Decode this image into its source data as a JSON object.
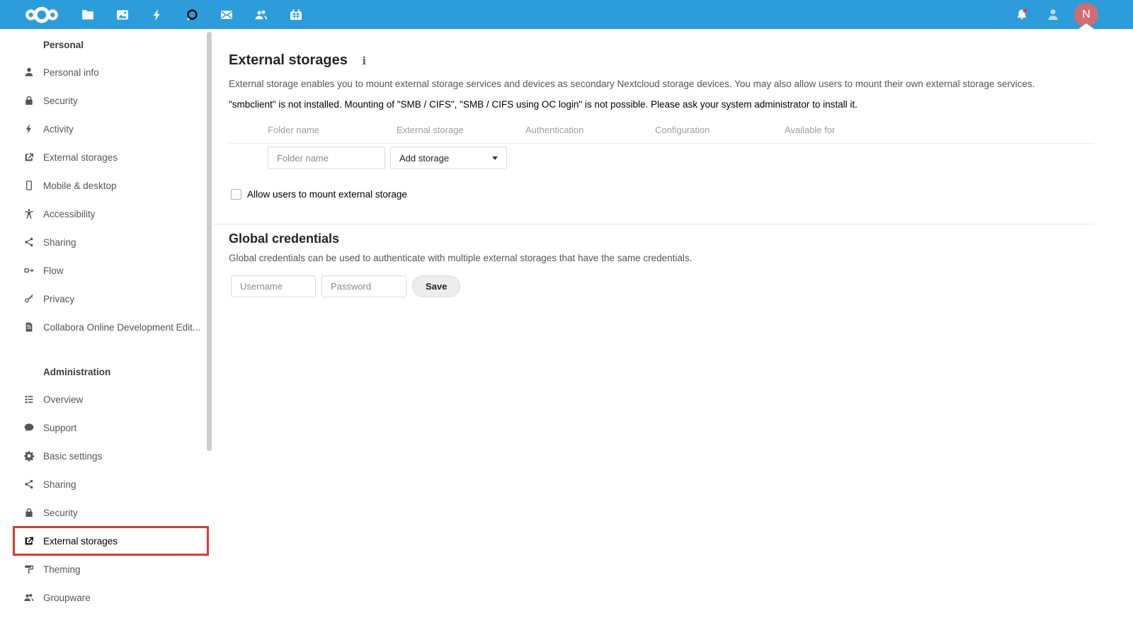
{
  "header": {
    "app_icons": [
      "files",
      "photos",
      "activity",
      "talk",
      "mail",
      "contacts",
      "calendar"
    ],
    "right_icons": [
      "notifications",
      "contacts-menu"
    ],
    "avatar_initial": "N"
  },
  "sidebar": {
    "personal_heading": "Personal",
    "personal_items": [
      "Personal info",
      "Security",
      "Activity",
      "External storages",
      "Mobile & desktop",
      "Accessibility",
      "Sharing",
      "Flow",
      "Privacy",
      "Collabora Online Development Edit..."
    ],
    "admin_heading": "Administration",
    "admin_items": [
      "Overview",
      "Support",
      "Basic settings",
      "Sharing",
      "Security",
      "External storages",
      "Theming",
      "Groupware"
    ],
    "active_item": "External storages"
  },
  "main": {
    "title": "External storages",
    "info_icon": "i",
    "description": "External storage enables you to mount external storage services and devices as secondary Nextcloud storage devices. You may also allow users to mount their own external storage services.",
    "warning": "\"smbclient\" is not installed. Mounting of \"SMB / CIFS\", \"SMB / CIFS using OC login\" is not possible. Please ask your system administrator to install it.",
    "table": {
      "headers": [
        "Folder name",
        "External storage",
        "Authentication",
        "Configuration",
        "Available for"
      ]
    },
    "folder_placeholder": "Folder name",
    "add_storage_label": "Add storage",
    "allow_label": "Allow users to mount external storage",
    "gc": {
      "heading": "Global credentials",
      "description": "Global credentials can be used to authenticate with multiple external storages that have the same credentials.",
      "username_placeholder": "Username",
      "password_placeholder": "Password",
      "save_label": "Save"
    }
  },
  "colors": {
    "header_bg": "#2c9cda",
    "avatar_bg": "#cf6c75",
    "highlight_border": "#e2382c"
  }
}
